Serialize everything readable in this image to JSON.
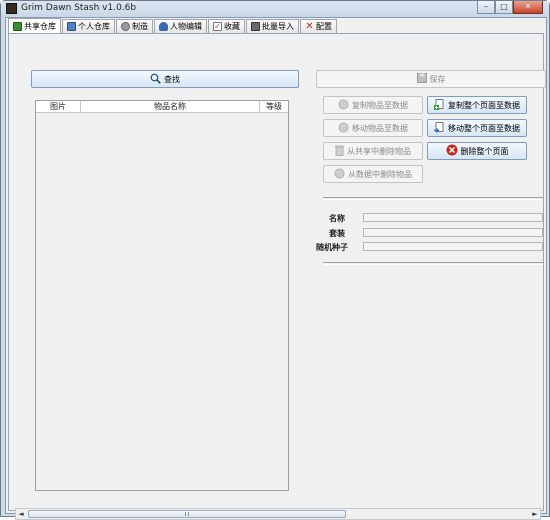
{
  "window": {
    "title": "Grim Dawn Stash v1.0.6b",
    "minimize_glyph": "–",
    "maximize_glyph": "□",
    "close_glyph": "✕"
  },
  "tabs": [
    {
      "label": "共享仓库",
      "icon": "chest-icon",
      "active": true
    },
    {
      "label": "个人仓库",
      "icon": "personal-chest-icon",
      "active": false
    },
    {
      "label": "制造",
      "icon": "gear-icon",
      "active": false
    },
    {
      "label": "人物编辑",
      "icon": "people-icon",
      "active": false
    },
    {
      "label": "收藏",
      "icon": "checkbox-icon",
      "active": false
    },
    {
      "label": "批量导入",
      "icon": "import-icon",
      "active": false
    },
    {
      "label": "配置",
      "icon": "tools-icon",
      "active": false
    }
  ],
  "search": {
    "label": "查找",
    "icon": "magnifier-icon"
  },
  "save": {
    "label": "保存",
    "icon": "floppy-icon"
  },
  "item_table": {
    "columns": [
      "图片",
      "物品名称",
      "等级"
    ],
    "rows": []
  },
  "actions_left": [
    {
      "label": "复制物品至数据",
      "enabled": false
    },
    {
      "label": "移动物品至数据",
      "enabled": false
    },
    {
      "label": "从共享中删除物品",
      "enabled": false
    },
    {
      "label": "从数据中删除物品",
      "enabled": false
    }
  ],
  "actions_right": [
    {
      "label": "复制整个页面至数据",
      "icon": "add-page-icon"
    },
    {
      "label": "移动整个页面至数据",
      "icon": "move-page-icon"
    },
    {
      "label": "删除整个页面",
      "icon": "delete-icon"
    }
  ],
  "details": {
    "name_label": "名称",
    "set_label": "套装",
    "seed_label": "随机种子",
    "name_value": "",
    "set_value": "",
    "seed_value": ""
  },
  "scrollbar": {
    "left_arrow": "◄",
    "right_arrow": "►"
  },
  "colors": {
    "accent_blue": "#d6e6f5",
    "delete_red": "#c0281c",
    "add_green": "#2e9a2e"
  }
}
